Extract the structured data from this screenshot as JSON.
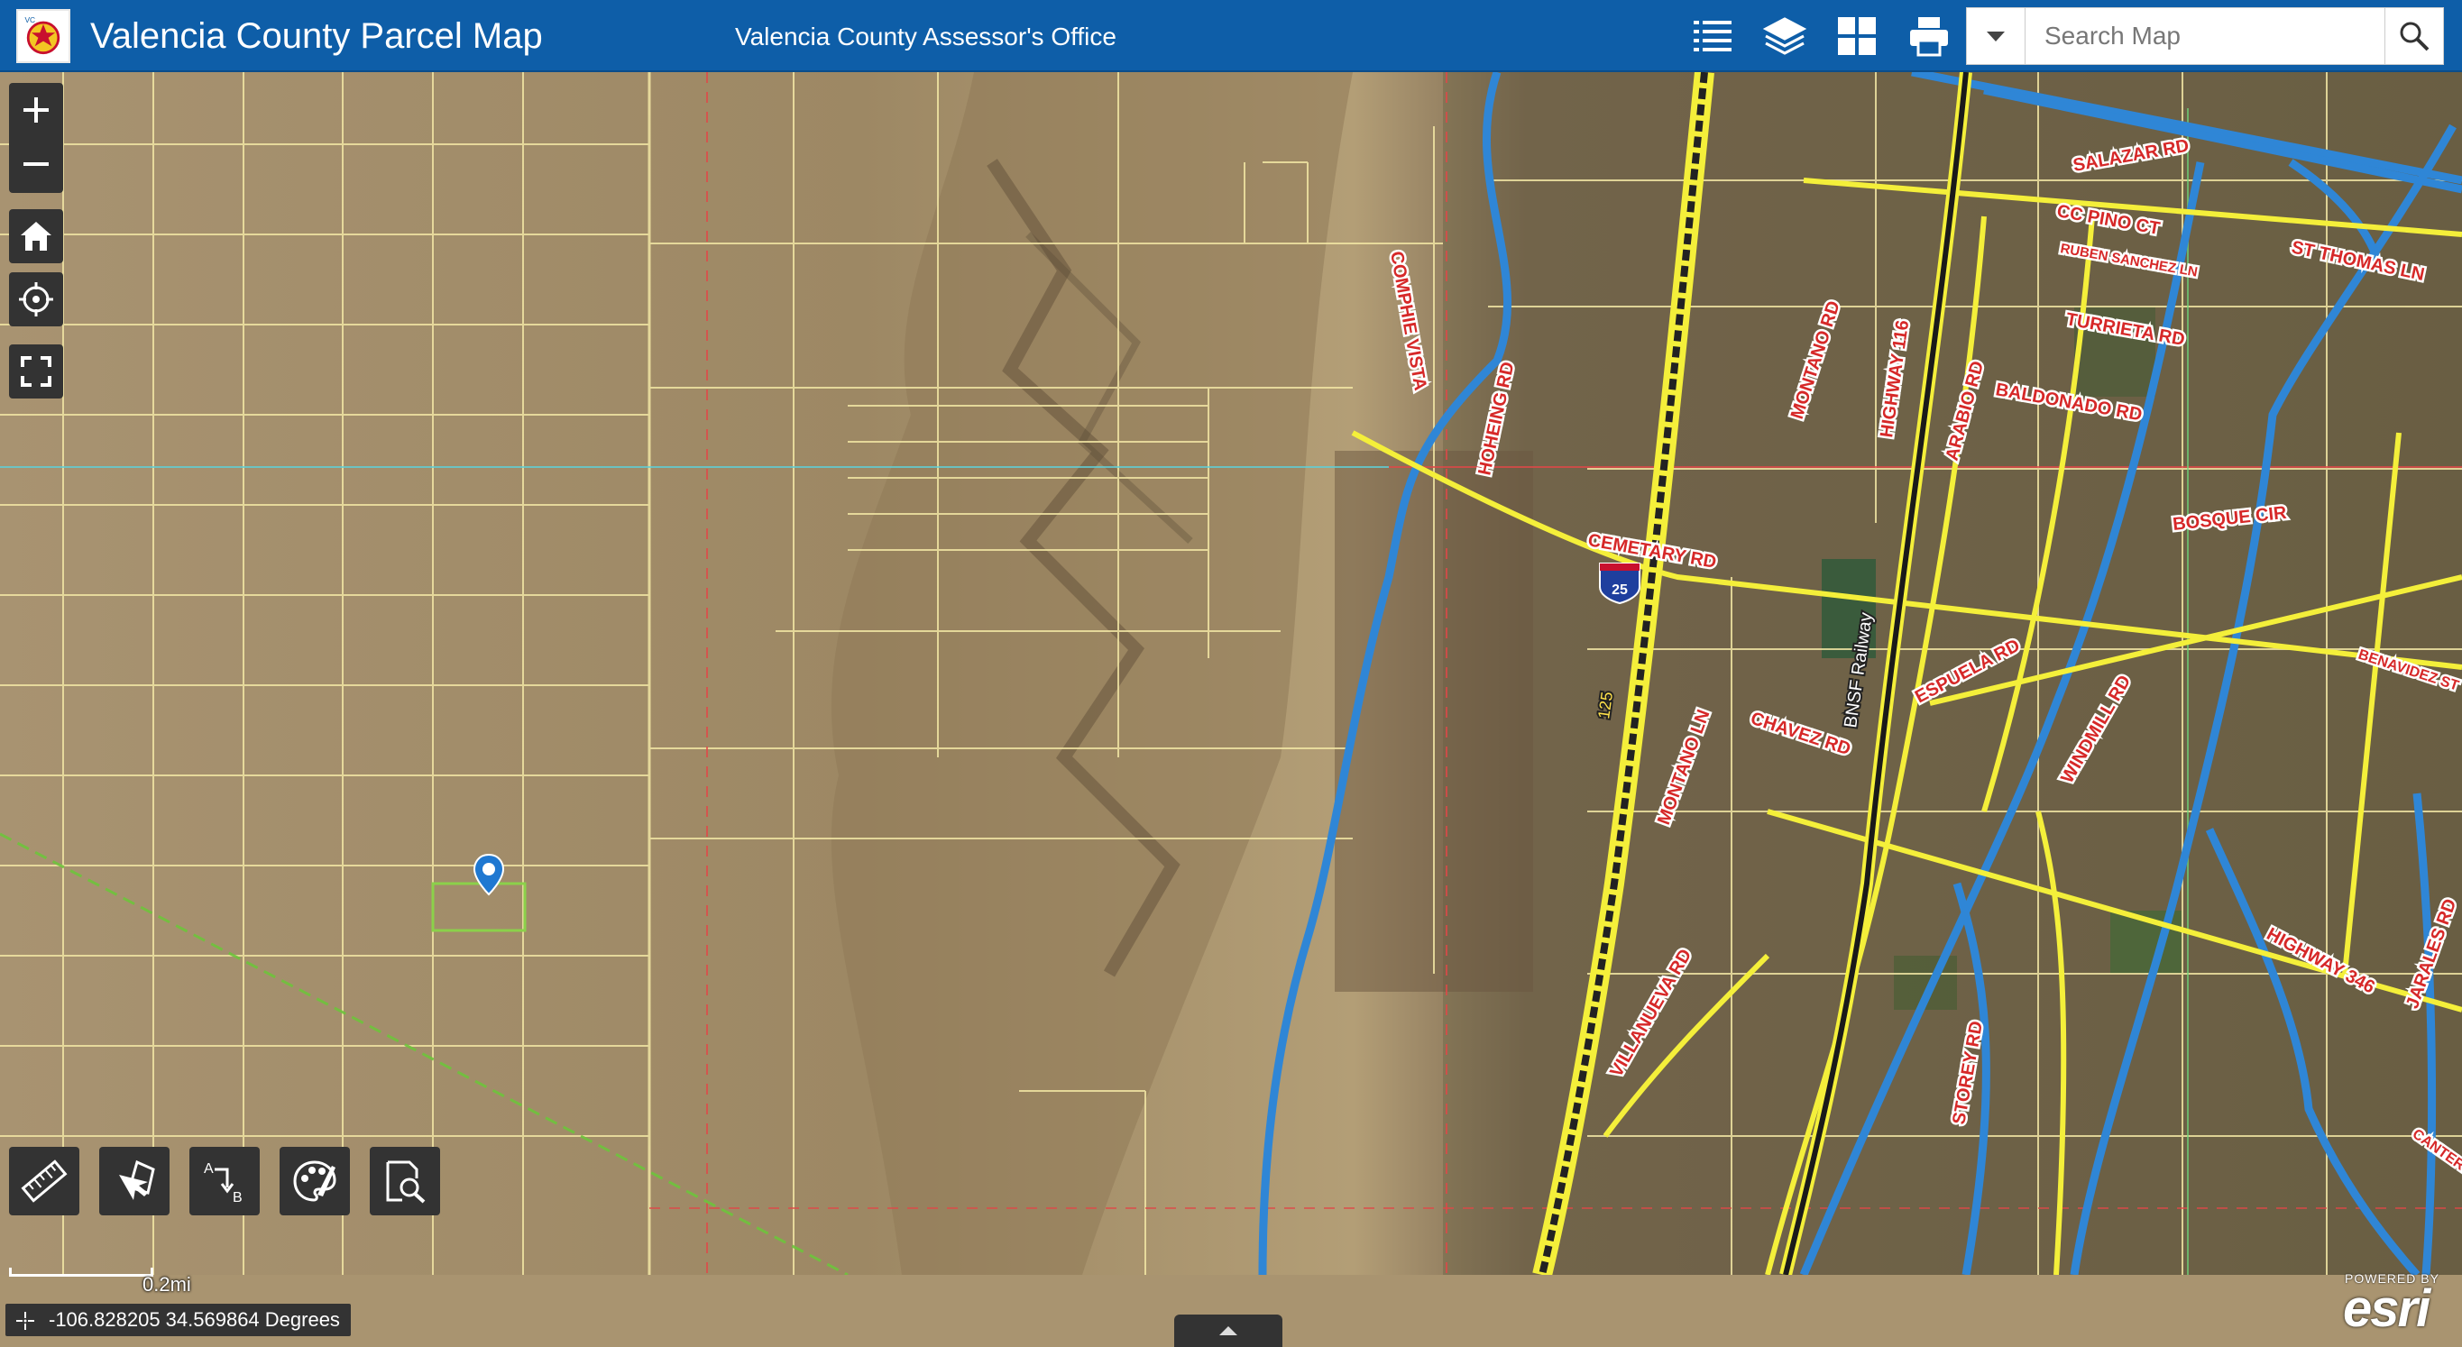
{
  "header": {
    "app_title": "Valencia County Parcel Map",
    "subtitle": "Valencia County Assessor's Office",
    "buttons": [
      {
        "name": "legend-button",
        "icon": "list-icon"
      },
      {
        "name": "layers-button",
        "icon": "layers-icon"
      },
      {
        "name": "basemap-button",
        "icon": "grid-icon"
      },
      {
        "name": "print-button",
        "icon": "printer-icon"
      }
    ]
  },
  "search": {
    "placeholder": "Search Map",
    "value": ""
  },
  "map_controls": {
    "zoom_in": "+",
    "zoom_out": "−"
  },
  "tools": [
    {
      "name": "measure-tool-button",
      "icon": "ruler-icon"
    },
    {
      "name": "select-tool-button",
      "icon": "select-cursor-icon"
    },
    {
      "name": "directions-tool-button",
      "icon": "a-to-b-icon"
    },
    {
      "name": "draw-tool-button",
      "icon": "palette-icon"
    },
    {
      "name": "query-tool-button",
      "icon": "document-search-icon"
    }
  ],
  "scale": {
    "label": "0.2mi"
  },
  "coordinates": {
    "text": "-106.828205 34.569864 Degrees"
  },
  "attribution": {
    "powered_by": "POWERED BY",
    "brand": "esri"
  },
  "road_labels": [
    {
      "text": "COMPHIE VISTA"
    },
    {
      "text": "CEMETARY RD"
    },
    {
      "text": "HOHEING RD"
    },
    {
      "text": "MONTANO RD"
    },
    {
      "text": "HIGHWAY 116"
    },
    {
      "text": "ARABIO RD"
    },
    {
      "text": "BALDONADO RD"
    },
    {
      "text": "TURRIETA RD"
    },
    {
      "text": "ST THOMAS LN"
    },
    {
      "text": "CC PINO CT"
    },
    {
      "text": "RUBEN SANCHEZ LN"
    },
    {
      "text": "SALAZAR RD"
    },
    {
      "text": "BOSQUE CIR"
    },
    {
      "text": "ESPUELA RD"
    },
    {
      "text": "CHAVEZ RD"
    },
    {
      "text": "MONTANO LN"
    },
    {
      "text": "WINDMILL RD"
    },
    {
      "text": "BENAVIDEZ ST"
    },
    {
      "text": "HIGHWAY 346"
    },
    {
      "text": "JARALES RD"
    },
    {
      "text": "VILLANUEVA RD"
    },
    {
      "text": "STOREY RD"
    },
    {
      "text": "CANTER LN"
    },
    {
      "text": "BNSF Railway"
    },
    {
      "text": "125"
    },
    {
      "text": "25"
    }
  ],
  "colors": {
    "header": "#0e5ea8",
    "control_bg": "#333333",
    "parcel_line": "#f2e6a4",
    "canal": "#2f86d6",
    "road_label": "#d62828",
    "highway": "#f4ef3a"
  }
}
